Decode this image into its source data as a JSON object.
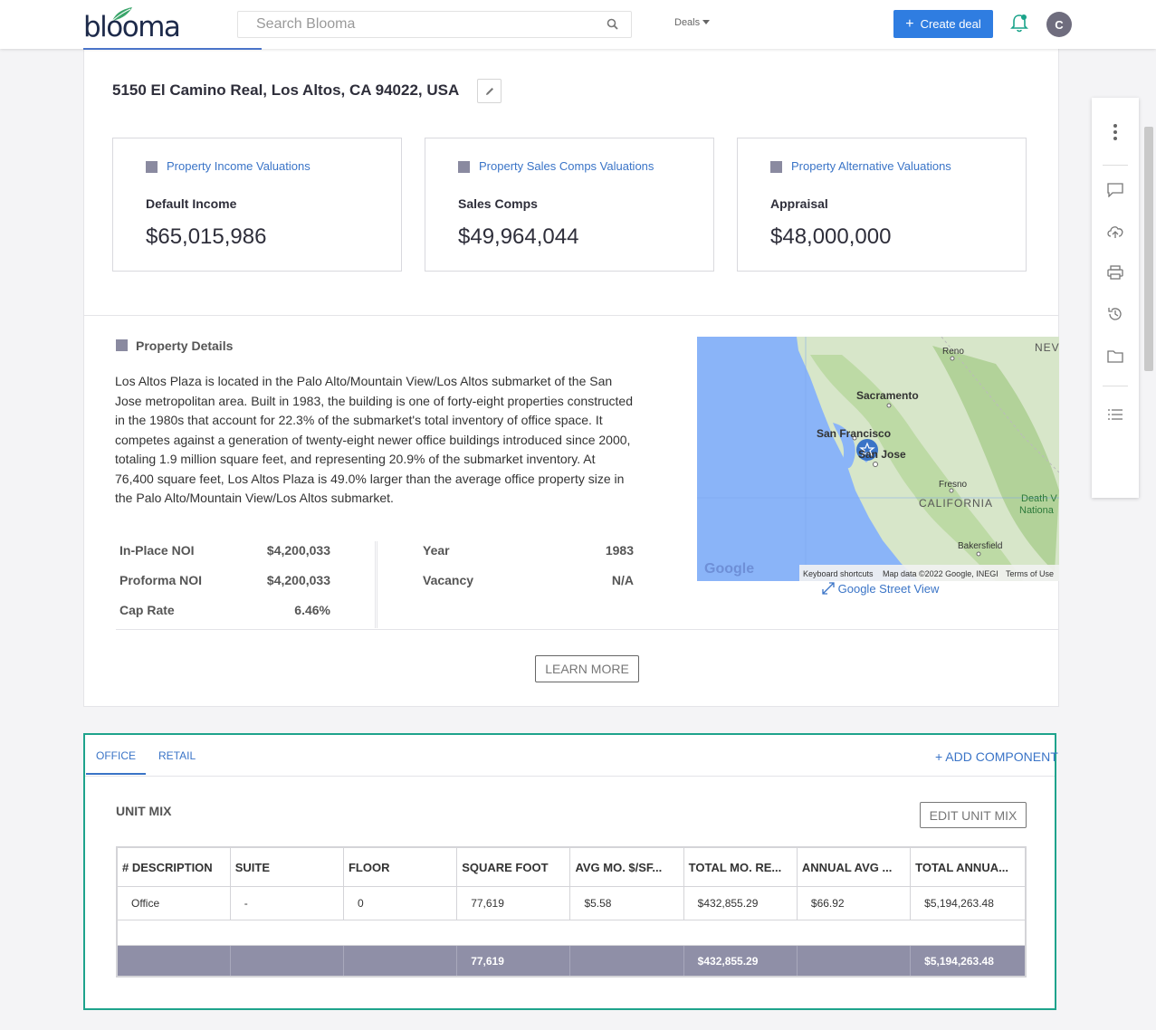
{
  "nav": {
    "search_placeholder": "Search Blooma",
    "deals_label": "Deals",
    "create_deal_label": "Create deal",
    "avatar_initial": "C",
    "logo_text": "blooma"
  },
  "property": {
    "address": "5150 El Camino Real, Los Altos, CA 94022, USA"
  },
  "valuations": [
    {
      "link": "Property Income Valuations",
      "label": "Default Income",
      "amount": "$65,015,986"
    },
    {
      "link": "Property Sales Comps Valuations",
      "label": "Sales Comps",
      "amount": "$49,964,044"
    },
    {
      "link": "Property Alternative Valuations",
      "label": "Appraisal",
      "amount": "$48,000,000"
    }
  ],
  "details": {
    "title": "Property Details",
    "description": "Los Altos Plaza is located in the Palo Alto/Mountain View/Los Altos submarket of the San Jose metropolitan area. Built in 1983, the building is one of forty-eight properties constructed in the 1980s that account for 22.3% of the submarket's total inventory of office space. It competes against a generation of twenty-eight newer office buildings introduced since 2000, totaling 1.9 million square feet, and representing 20.9% of the submarket inventory. At 76,400 square feet, Los Altos Plaza is 49.0% larger than the average office property size in the Palo Alto/Mountain View/Los Altos submarket.",
    "stats_left": [
      {
        "label": "In-Place NOI",
        "value": "$4,200,033"
      },
      {
        "label": "Proforma NOI",
        "value": "$4,200,033"
      },
      {
        "label": "Cap Rate",
        "value": "6.46%"
      }
    ],
    "stats_right": [
      {
        "label": "Year",
        "value": "1983"
      },
      {
        "label": "Vacancy",
        "value": "N/A"
      }
    ],
    "learn_more_label": "LEARN MORE"
  },
  "map": {
    "labels": {
      "reno": "Reno",
      "nev": "NEV",
      "sacramento": "Sacramento",
      "san_francisco": "San Francisco",
      "san_jose": "San Jose",
      "fresno": "Fresno",
      "california": "CALIFORNIA",
      "death_valley_1": "Death V",
      "death_valley_2": "Nationa",
      "bakersfield": "Bakersfield"
    },
    "google_logo": "Google",
    "keyboard_shortcuts": "Keyboard shortcuts",
    "map_data": "Map data ©2022 Google, INEGI",
    "terms": "Terms of Use",
    "street_view_label": "Google Street View"
  },
  "components": {
    "tabs": [
      "OFFICE",
      "RETAIL"
    ],
    "active_tab": "OFFICE",
    "add_component_label": "+ ADD COMPONENT",
    "unit_mix_title": "UNIT MIX",
    "edit_unit_mix_label": "EDIT UNIT MIX",
    "table": {
      "headers": [
        "# DESCRIPTION",
        "SUITE",
        "FLOOR",
        "SQUARE FOOT",
        "AVG MO. $/SF...",
        "TOTAL MO. RE...",
        "ANNUAL AVG ...",
        "TOTAL ANNUA..."
      ],
      "rows": [
        [
          "Office",
          "-",
          "0",
          "77,619",
          "$5.58",
          "$432,855.29",
          "$66.92",
          "$5,194,263.48"
        ]
      ],
      "totals": [
        "",
        "",
        "",
        "77,619",
        "",
        "$432,855.29",
        "",
        "$5,194,263.48"
      ]
    }
  },
  "colors": {
    "accent_blue": "#2f7de1",
    "link_blue": "#3a74c7",
    "highlight_green": "#1ea38c",
    "total_row": "#8f8fa7",
    "bell_green": "#1aa38a"
  }
}
